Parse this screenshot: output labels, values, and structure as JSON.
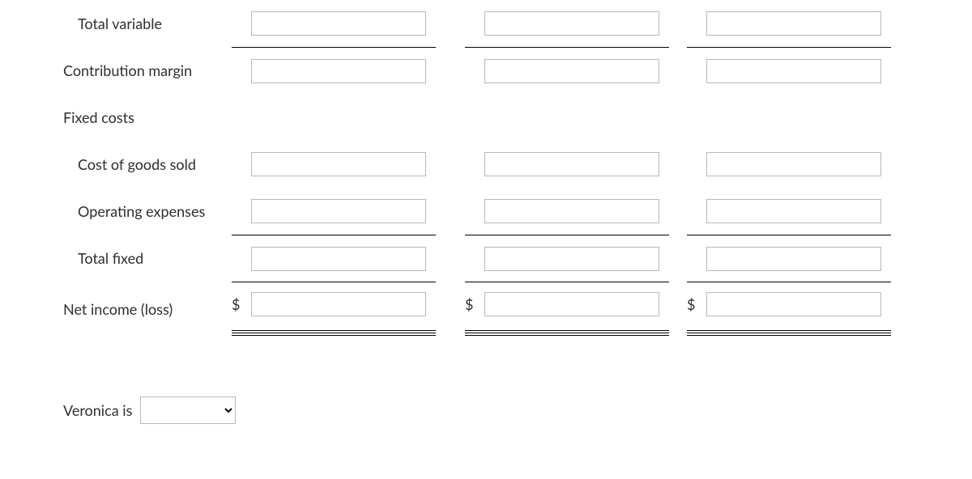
{
  "rows": {
    "total_variable": {
      "label": "Total variable",
      "v1": "",
      "v2": "",
      "v3": ""
    },
    "contribution_margin": {
      "label": "Contribution margin",
      "v1": "",
      "v2": "",
      "v3": ""
    },
    "fixed_costs_header": {
      "label": "Fixed costs"
    },
    "cogs": {
      "label": "Cost of goods sold",
      "v1": "",
      "v2": "",
      "v3": ""
    },
    "opex": {
      "label": "Operating expenses",
      "v1": "",
      "v2": "",
      "v3": ""
    },
    "total_fixed": {
      "label": "Total fixed",
      "v1": "",
      "v2": "",
      "v3": ""
    },
    "net_income": {
      "label": "Net income (loss)",
      "prefix": "$",
      "v1": "",
      "v2": "",
      "v3": ""
    }
  },
  "sentence": {
    "lead": "Veronica is",
    "selected": ""
  }
}
